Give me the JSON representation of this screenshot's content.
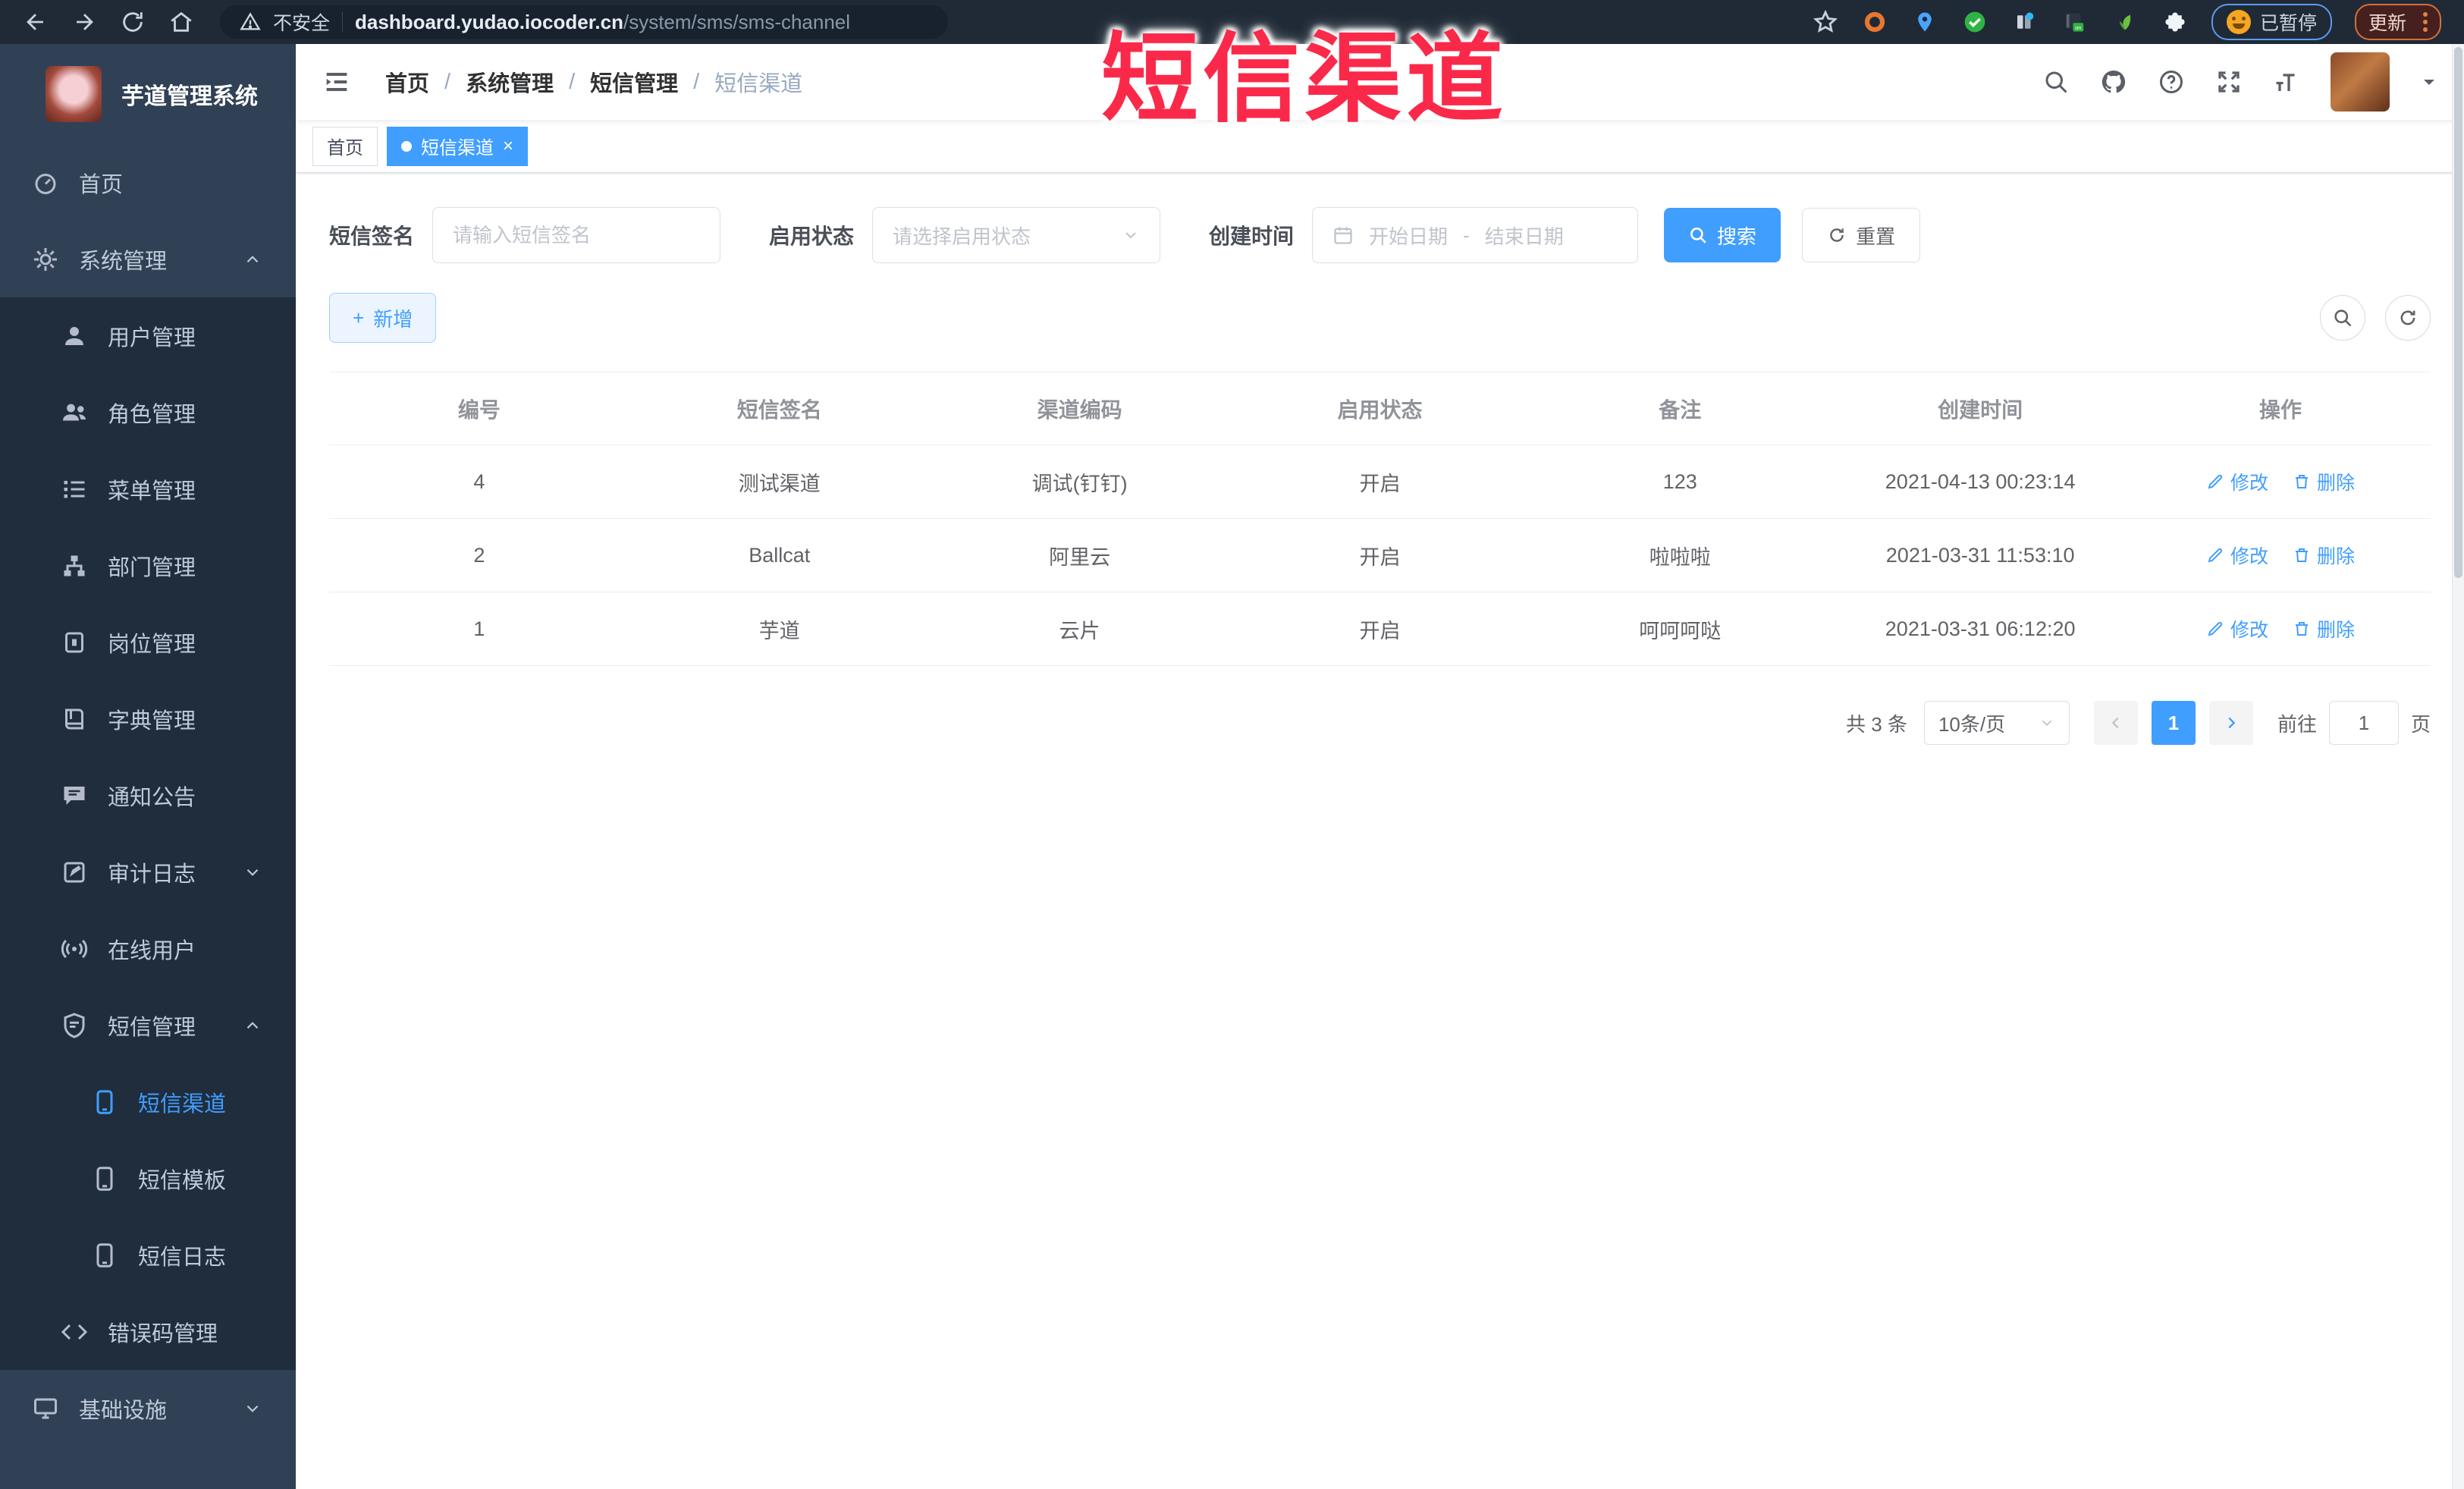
{
  "browser": {
    "security_label": "不安全",
    "url_host": "dashboard.yudao.iocoder.cn",
    "url_path": "/system/sms/sms-channel",
    "paused_label": "已暂停",
    "update_label": "更新"
  },
  "watermark": "短信渠道",
  "sidebar": {
    "app_title": "芋道管理系统",
    "items": [
      {
        "label": "首页"
      },
      {
        "label": "系统管理"
      },
      {
        "label": "用户管理"
      },
      {
        "label": "角色管理"
      },
      {
        "label": "菜单管理"
      },
      {
        "label": "部门管理"
      },
      {
        "label": "岗位管理"
      },
      {
        "label": "字典管理"
      },
      {
        "label": "通知公告"
      },
      {
        "label": "审计日志"
      },
      {
        "label": "在线用户"
      },
      {
        "label": "短信管理"
      },
      {
        "label": "短信渠道"
      },
      {
        "label": "短信模板"
      },
      {
        "label": "短信日志"
      },
      {
        "label": "错误码管理"
      },
      {
        "label": "基础设施"
      }
    ]
  },
  "header": {
    "breadcrumb": [
      "首页",
      "系统管理",
      "短信管理",
      "短信渠道"
    ]
  },
  "tabs": [
    {
      "label": "首页"
    },
    {
      "label": "短信渠道"
    }
  ],
  "search_form": {
    "sign_label": "短信签名",
    "sign_placeholder": "请输入短信签名",
    "status_label": "启用状态",
    "status_placeholder": "请选择启用状态",
    "date_label": "创建时间",
    "date_start": "开始日期",
    "date_sep": "-",
    "date_end": "结束日期",
    "search_label": "搜索",
    "reset_label": "重置"
  },
  "toolbar": {
    "add_label": "新增"
  },
  "table": {
    "columns": [
      "编号",
      "短信签名",
      "渠道编码",
      "启用状态",
      "备注",
      "创建时间",
      "操作"
    ],
    "edit_label": "修改",
    "delete_label": "删除",
    "rows": [
      {
        "id": "4",
        "sign": "测试渠道",
        "code": "调试(钉钉)",
        "status": "开启",
        "remark": "123",
        "created": "2021-04-13 00:23:14"
      },
      {
        "id": "2",
        "sign": "Ballcat",
        "code": "阿里云",
        "status": "开启",
        "remark": "啦啦啦",
        "created": "2021-03-31 11:53:10"
      },
      {
        "id": "1",
        "sign": "芋道",
        "code": "云片",
        "status": "开启",
        "remark": "呵呵呵哒",
        "created": "2021-03-31 06:12:20"
      }
    ]
  },
  "pagination": {
    "total": "共 3 条",
    "page_size": "10条/页",
    "page": "1",
    "goto_label": "前往",
    "goto_value": "1",
    "unit_label": "页"
  },
  "colors": {
    "accent": "#409eff",
    "watermark_red": "#fb2949",
    "sidebar_bg": "#304156",
    "submenu_bg": "#1f2d3d"
  }
}
